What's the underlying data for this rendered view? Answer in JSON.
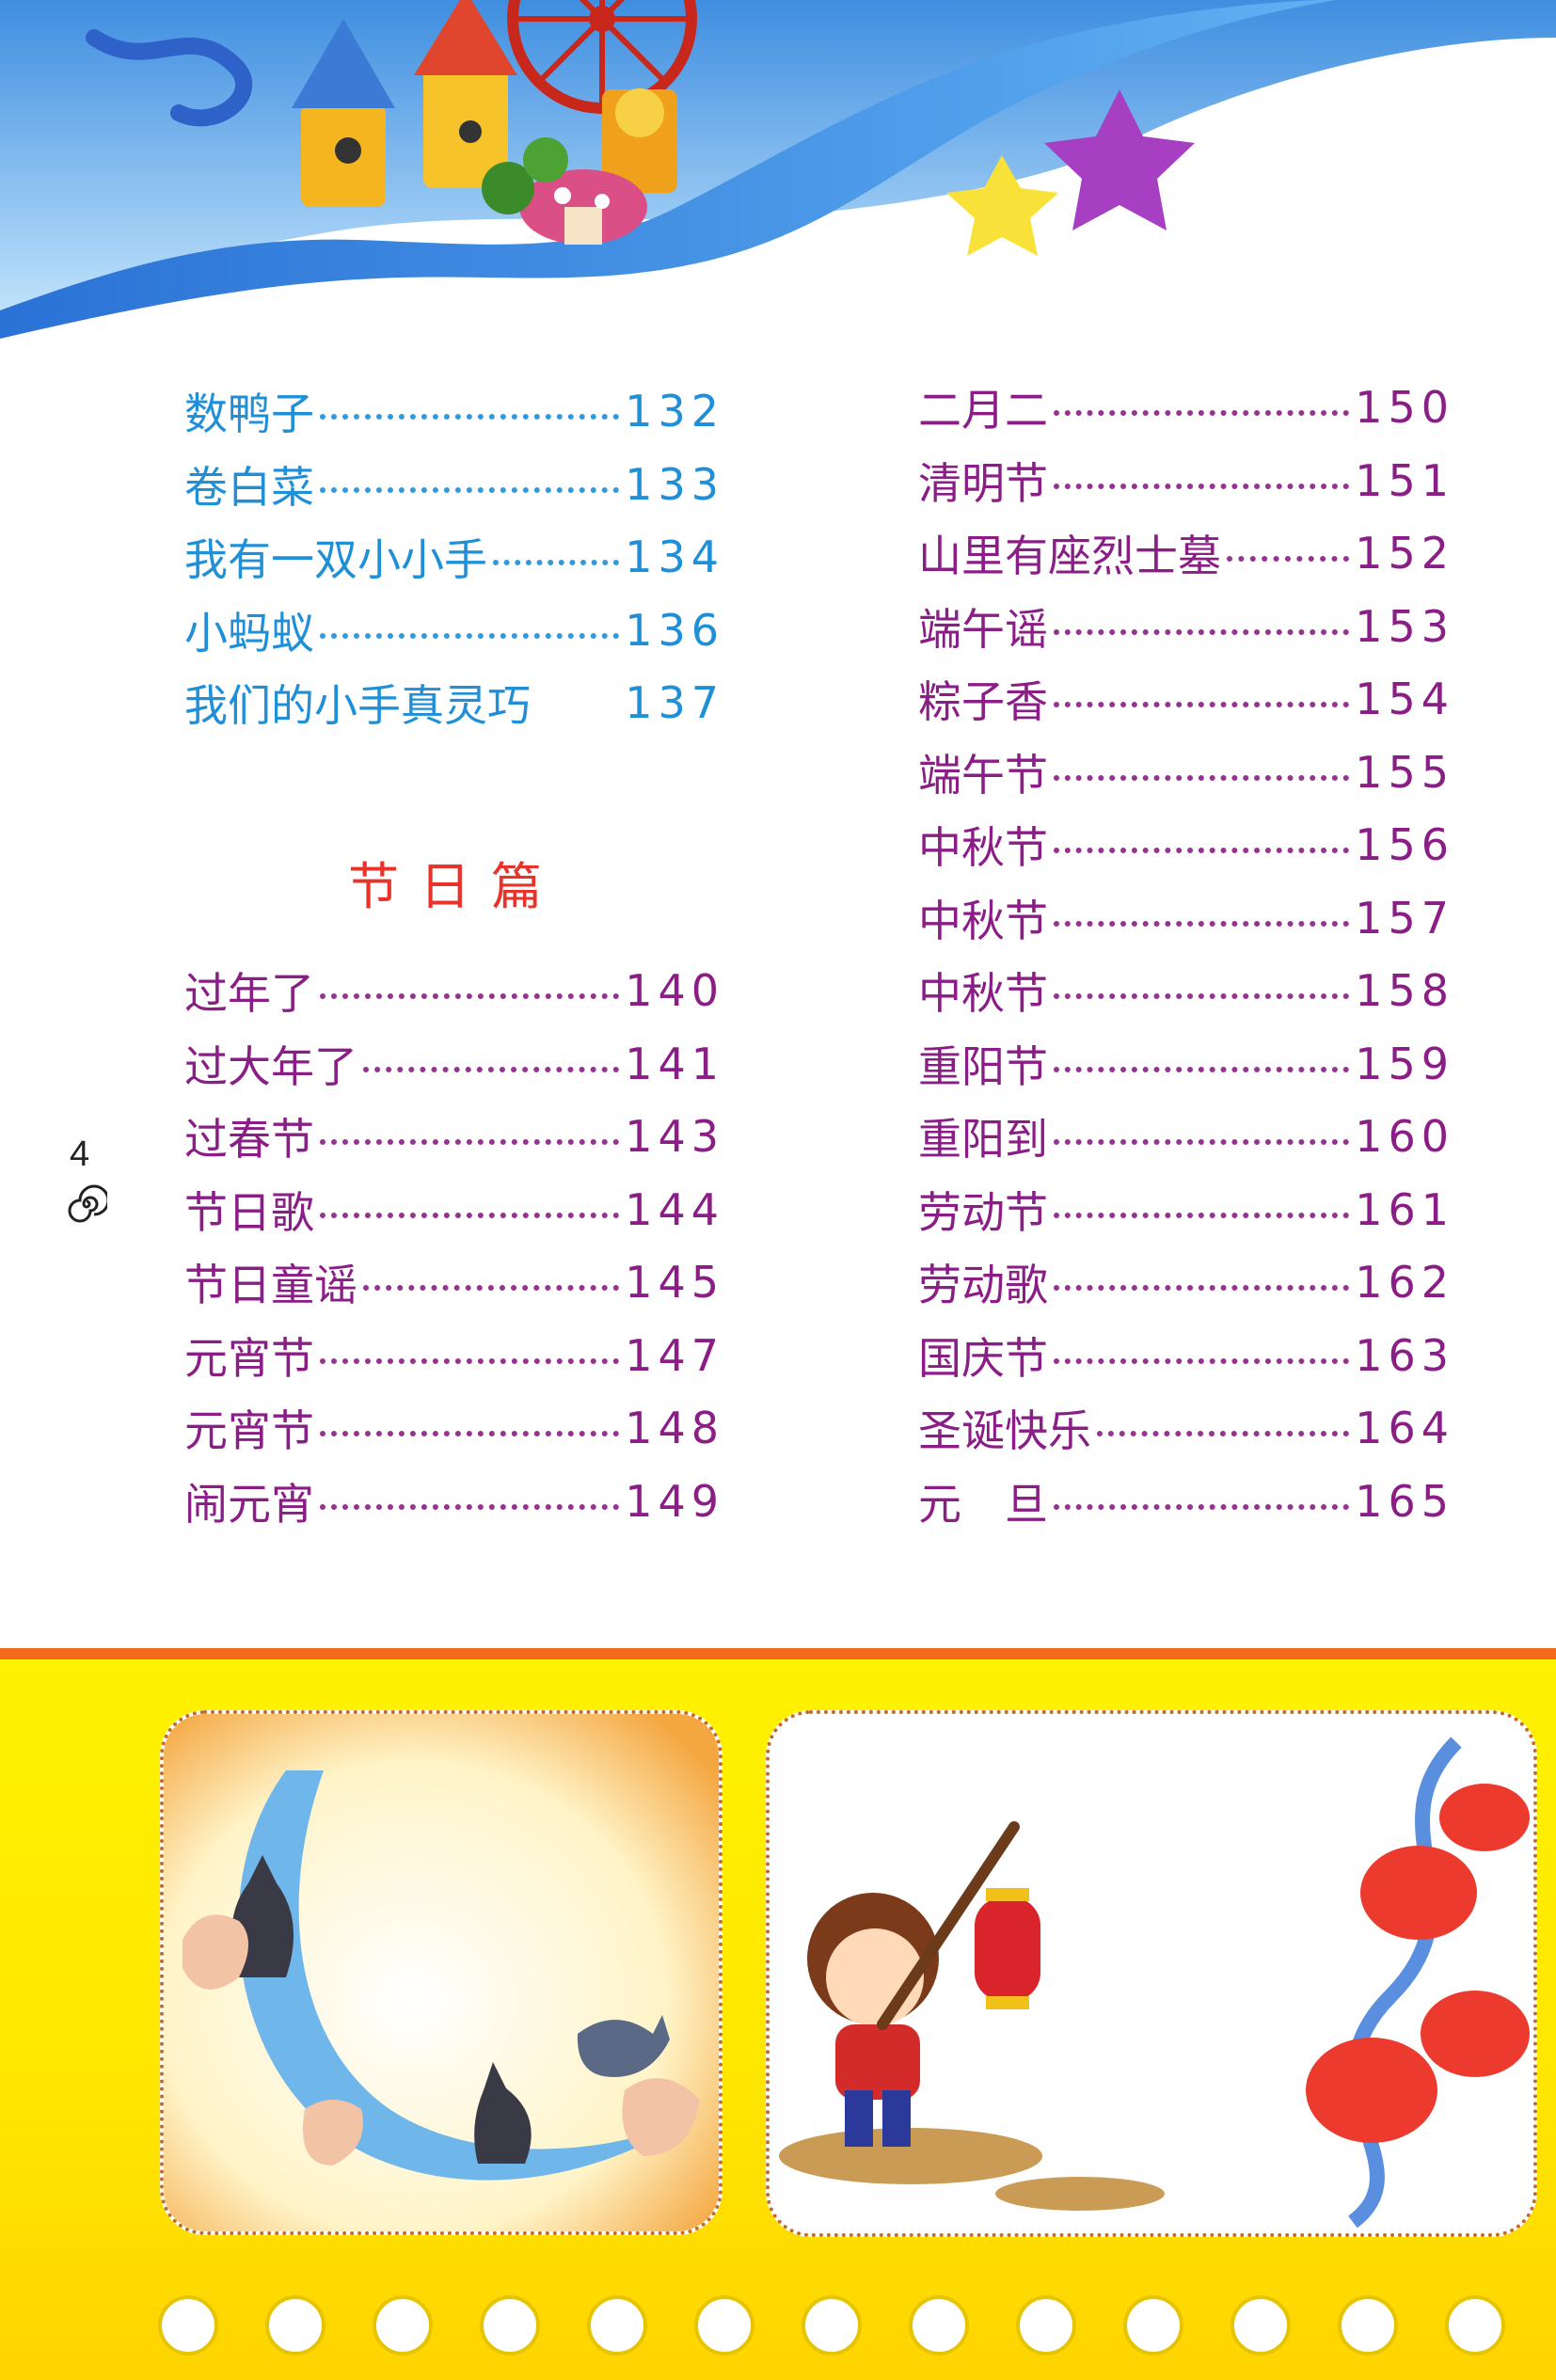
{
  "left_column": [
    {
      "title": "数鸭子",
      "page": "132",
      "leader": "dots",
      "color": "#1f8fd8"
    },
    {
      "title": "卷白菜",
      "page": "133",
      "leader": "dots",
      "color": "#1f8fd8"
    },
    {
      "title": "我有一双小小手",
      "page": "134",
      "leader": "dots",
      "color": "#1f8fd8"
    },
    {
      "title": "小蚂蚁",
      "page": "136",
      "leader": "dots",
      "color": "#1f8fd8"
    },
    {
      "title": "我们的小手真灵巧",
      "page": "137",
      "leader": "none",
      "color": "#1f8fd8"
    }
  ],
  "section_heading": "节日篇",
  "left_column_2": [
    {
      "title": "过年了",
      "page": "140",
      "leader": "dots",
      "color": "#8b1d86"
    },
    {
      "title": "过大年了",
      "page": "141",
      "leader": "dots",
      "color": "#8b1d86"
    },
    {
      "title": "过春节",
      "page": "143",
      "leader": "dots",
      "color": "#8b1d86"
    },
    {
      "title": "节日歌",
      "page": "144",
      "leader": "dots",
      "color": "#8b1d86"
    },
    {
      "title": "节日童谣",
      "page": "145",
      "leader": "dots",
      "color": "#8b1d86"
    },
    {
      "title": "元宵节",
      "page": "147",
      "leader": "dots",
      "color": "#8b1d86"
    },
    {
      "title": "元宵节",
      "page": "148",
      "leader": "dots",
      "color": "#8b1d86"
    },
    {
      "title": "闹元宵",
      "page": "149",
      "leader": "dots",
      "color": "#8b1d86"
    }
  ],
  "right_column": [
    {
      "title": "二月二",
      "page": "150",
      "leader": "dots",
      "color": "#8b1d86"
    },
    {
      "title": "清明节",
      "page": "151",
      "leader": "dots",
      "color": "#8b1d86"
    },
    {
      "title": "山里有座烈士墓",
      "page": "152",
      "leader": "dots",
      "color": "#8b1d86"
    },
    {
      "title": "端午谣",
      "page": "153",
      "leader": "dots",
      "color": "#8b1d86"
    },
    {
      "title": "粽子香",
      "page": "154",
      "leader": "dots",
      "color": "#8b1d86"
    },
    {
      "title": "端午节",
      "page": "155",
      "leader": "dots",
      "color": "#8b1d86"
    },
    {
      "title": "中秋节",
      "page": "156",
      "leader": "dots",
      "color": "#8b1d86"
    },
    {
      "title": "中秋节",
      "page": "157",
      "leader": "dots",
      "color": "#8b1d86"
    },
    {
      "title": "中秋节",
      "page": "158",
      "leader": "dots",
      "color": "#8b1d86"
    },
    {
      "title": "重阳节",
      "page": "159",
      "leader": "dots",
      "color": "#8b1d86"
    },
    {
      "title": "重阳到",
      "page": "160",
      "leader": "dots",
      "color": "#8b1d86"
    },
    {
      "title": "劳动节",
      "page": "161",
      "leader": "dots",
      "color": "#8b1d86"
    },
    {
      "title": "劳动歌",
      "page": "162",
      "leader": "dots",
      "color": "#8b1d86"
    },
    {
      "title": "国庆节",
      "page": "163",
      "leader": "dots",
      "color": "#8b1d86"
    },
    {
      "title": "圣诞快乐",
      "page": "164",
      "leader": "dots",
      "color": "#8b1d86"
    },
    {
      "title": "元　旦",
      "page": "165",
      "leader": "dots",
      "color": "#8b1d86"
    }
  ],
  "page_number": "4",
  "colors": {
    "heading": "#e8322a",
    "blue_entries": "#1f8fd8",
    "purple_entries": "#8b1d86",
    "bottom_band": "#ffe600",
    "bottom_border": "#f36a1e"
  },
  "icons": [
    "swirl-icon",
    "star-icon",
    "ferris-wheel-icon",
    "castle-icon",
    "mushroom-icon",
    "lantern-icon",
    "cat-shadow-icon"
  ]
}
